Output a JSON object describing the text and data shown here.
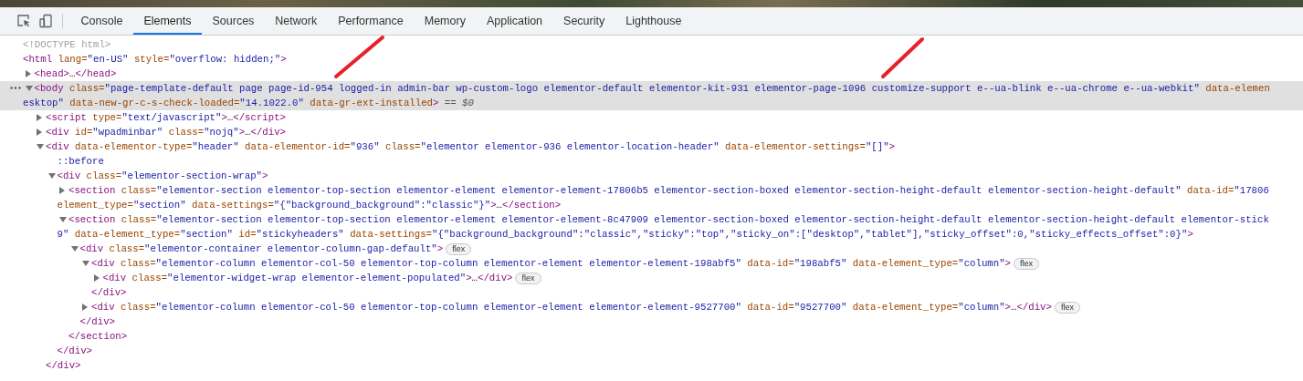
{
  "toolbar": {
    "tabs": [
      {
        "label": "Console",
        "selected": false
      },
      {
        "label": "Elements",
        "selected": true
      },
      {
        "label": "Sources",
        "selected": false
      },
      {
        "label": "Network",
        "selected": false
      },
      {
        "label": "Performance",
        "selected": false
      },
      {
        "label": "Memory",
        "selected": false
      },
      {
        "label": "Application",
        "selected": false
      },
      {
        "label": "Security",
        "selected": false
      },
      {
        "label": "Lighthouse",
        "selected": false
      }
    ]
  },
  "dom_tree": [
    {
      "selected": false,
      "lines": [
        [
          {
            "kind": "doctype",
            "text": "<!DOCTYPE html>"
          }
        ]
      ]
    },
    {
      "selected": false,
      "lines": [
        [
          {
            "kind": "tag",
            "text": "<html"
          },
          {
            "kind": "attr",
            "text": " lang="
          },
          {
            "kind": "value",
            "text": "\"en-US\""
          },
          {
            "kind": "attr",
            "text": " style="
          },
          {
            "kind": "value",
            "text": "\"overflow: hidden;\""
          },
          {
            "kind": "tag",
            "text": ">"
          }
        ]
      ],
      "children": [
        {
          "expanded": false,
          "selected": false,
          "lines": [
            [
              {
                "kind": "tag",
                "text": "<head>"
              },
              {
                "kind": "plain",
                "text": "…"
              },
              {
                "kind": "tag",
                "text": "</head>"
              }
            ]
          ]
        },
        {
          "expanded": true,
          "selected": true,
          "lines": [
            [
              {
                "kind": "tag",
                "text": "<body"
              },
              {
                "kind": "attr",
                "text": " class="
              },
              {
                "kind": "value",
                "text": "\"page-template-default page page-id-954 logged-in admin-bar wp-custom-logo elementor-default elementor-kit-931 elementor-page-1096 customize-support e--ua-blink e--ua-chrome e--ua-webkit\""
              },
              {
                "kind": "attr",
                "text": " data-elemen"
              }
            ],
            [
              {
                "kind": "value",
                "text": "esktop\""
              },
              {
                "kind": "attr",
                "text": " data-new-gr-c-s-check-loaded="
              },
              {
                "kind": "value",
                "text": "\"14.1022.0\""
              },
              {
                "kind": "attr",
                "text": " data-gr-ext-installed"
              },
              {
                "kind": "tag",
                "text": ">"
              },
              {
                "kind": "ref",
                "text": " == $0"
              }
            ]
          ],
          "children": [
            {
              "expanded": false,
              "selected": false,
              "lines": [
                [
                  {
                    "kind": "tag",
                    "text": "<script"
                  },
                  {
                    "kind": "attr",
                    "text": " type="
                  },
                  {
                    "kind": "value",
                    "text": "\"text/javascript\""
                  },
                  {
                    "kind": "tag",
                    "text": ">"
                  },
                  {
                    "kind": "plain",
                    "text": "…"
                  },
                  {
                    "kind": "tag",
                    "text": "</script>"
                  }
                ]
              ]
            },
            {
              "expanded": false,
              "selected": false,
              "lines": [
                [
                  {
                    "kind": "tag",
                    "text": "<div"
                  },
                  {
                    "kind": "attr",
                    "text": " id="
                  },
                  {
                    "kind": "value",
                    "text": "\"wpadminbar\""
                  },
                  {
                    "kind": "attr",
                    "text": " class="
                  },
                  {
                    "kind": "value",
                    "text": "\"nojq\""
                  },
                  {
                    "kind": "tag",
                    "text": ">"
                  },
                  {
                    "kind": "plain",
                    "text": "…"
                  },
                  {
                    "kind": "tag",
                    "text": "</div>"
                  }
                ]
              ]
            },
            {
              "expanded": true,
              "selected": false,
              "lines": [
                [
                  {
                    "kind": "tag",
                    "text": "<div"
                  },
                  {
                    "kind": "attr",
                    "text": " data-elementor-type="
                  },
                  {
                    "kind": "value",
                    "text": "\"header\""
                  },
                  {
                    "kind": "attr",
                    "text": " data-elementor-id="
                  },
                  {
                    "kind": "value",
                    "text": "\"936\""
                  },
                  {
                    "kind": "attr",
                    "text": " class="
                  },
                  {
                    "kind": "value",
                    "text": "\"elementor elementor-936 elementor-location-header\""
                  },
                  {
                    "kind": "attr",
                    "text": " data-elementor-settings="
                  },
                  {
                    "kind": "value",
                    "text": "\"[]\""
                  },
                  {
                    "kind": "tag",
                    "text": ">"
                  }
                ]
              ],
              "children": [
                {
                  "selected": false,
                  "lines": [
                    [
                      {
                        "kind": "pseudo",
                        "text": "::before"
                      }
                    ]
                  ]
                },
                {
                  "expanded": true,
                  "selected": false,
                  "lines": [
                    [
                      {
                        "kind": "tag",
                        "text": "<div"
                      },
                      {
                        "kind": "attr",
                        "text": " class="
                      },
                      {
                        "kind": "value",
                        "text": "\"elementor-section-wrap\""
                      },
                      {
                        "kind": "tag",
                        "text": ">"
                      }
                    ]
                  ],
                  "children": [
                    {
                      "expanded": false,
                      "selected": false,
                      "lines": [
                        [
                          {
                            "kind": "tag",
                            "text": "<section"
                          },
                          {
                            "kind": "attr",
                            "text": " class="
                          },
                          {
                            "kind": "value",
                            "text": "\"elementor-section elementor-top-section elementor-element elementor-element-17806b5 elementor-section-boxed elementor-section-height-default elementor-section-height-default\""
                          },
                          {
                            "kind": "attr",
                            "text": " data-id="
                          },
                          {
                            "kind": "value",
                            "text": "\"17806"
                          }
                        ],
                        [
                          {
                            "kind": "attr",
                            "text": "element_type="
                          },
                          {
                            "kind": "value",
                            "text": "\"section\""
                          },
                          {
                            "kind": "attr",
                            "text": " data-settings="
                          },
                          {
                            "kind": "value",
                            "text": "\"{\"background_background\":\"classic\"}\""
                          },
                          {
                            "kind": "tag",
                            "text": ">"
                          },
                          {
                            "kind": "plain",
                            "text": "…"
                          },
                          {
                            "kind": "tag",
                            "text": "</section>"
                          }
                        ]
                      ]
                    },
                    {
                      "expanded": true,
                      "selected": false,
                      "lines": [
                        [
                          {
                            "kind": "tag",
                            "text": "<section"
                          },
                          {
                            "kind": "attr",
                            "text": " class="
                          },
                          {
                            "kind": "value",
                            "text": "\"elementor-section elementor-top-section elementor-element elementor-element-8c47909 elementor-section-boxed elementor-section-height-default elementor-section-height-default elementor-stick"
                          }
                        ],
                        [
                          {
                            "kind": "value",
                            "text": "9\""
                          },
                          {
                            "kind": "attr",
                            "text": " data-element_type="
                          },
                          {
                            "kind": "value",
                            "text": "\"section\""
                          },
                          {
                            "kind": "attr",
                            "text": " id="
                          },
                          {
                            "kind": "value",
                            "text": "\"stickyheaders\""
                          },
                          {
                            "kind": "attr",
                            "text": " data-settings="
                          },
                          {
                            "kind": "value",
                            "text": "\"{\"background_background\":\"classic\",\"sticky\":\"top\",\"sticky_on\":[\"desktop\",\"tablet\"],\"sticky_offset\":0,\"sticky_effects_offset\":0}\""
                          },
                          {
                            "kind": "tag",
                            "text": ">"
                          }
                        ]
                      ],
                      "children": [
                        {
                          "expanded": true,
                          "selected": false,
                          "badge": "flex",
                          "lines": [
                            [
                              {
                                "kind": "tag",
                                "text": "<div"
                              },
                              {
                                "kind": "attr",
                                "text": " class="
                              },
                              {
                                "kind": "value",
                                "text": "\"elementor-container elementor-column-gap-default\""
                              },
                              {
                                "kind": "tag",
                                "text": ">"
                              }
                            ]
                          ],
                          "children": [
                            {
                              "expanded": true,
                              "selected": false,
                              "badge": "flex",
                              "lines": [
                                [
                                  {
                                    "kind": "tag",
                                    "text": "<div"
                                  },
                                  {
                                    "kind": "attr",
                                    "text": " class="
                                  },
                                  {
                                    "kind": "value",
                                    "text": "\"elementor-column elementor-col-50 elementor-top-column elementor-element elementor-element-198abf5\""
                                  },
                                  {
                                    "kind": "attr",
                                    "text": " data-id="
                                  },
                                  {
                                    "kind": "value",
                                    "text": "\"198abf5\""
                                  },
                                  {
                                    "kind": "attr",
                                    "text": " data-element_type="
                                  },
                                  {
                                    "kind": "value",
                                    "text": "\"column\""
                                  },
                                  {
                                    "kind": "tag",
                                    "text": ">"
                                  }
                                ]
                              ],
                              "children": [
                                {
                                  "expanded": false,
                                  "selected": false,
                                  "badge": "flex",
                                  "lines": [
                                    [
                                      {
                                        "kind": "tag",
                                        "text": "<div"
                                      },
                                      {
                                        "kind": "attr",
                                        "text": " class="
                                      },
                                      {
                                        "kind": "value",
                                        "text": "\"elementor-widget-wrap elementor-element-populated\""
                                      },
                                      {
                                        "kind": "tag",
                                        "text": ">"
                                      },
                                      {
                                        "kind": "plain",
                                        "text": "…"
                                      },
                                      {
                                        "kind": "tag",
                                        "text": "</div>"
                                      }
                                    ]
                                  ]
                                }
                              ],
                              "closing": [
                                {
                                  "kind": "tag",
                                  "text": "</div>"
                                }
                              ]
                            },
                            {
                              "expanded": false,
                              "selected": false,
                              "badge": "flex",
                              "lines": [
                                [
                                  {
                                    "kind": "tag",
                                    "text": "<div"
                                  },
                                  {
                                    "kind": "attr",
                                    "text": " class="
                                  },
                                  {
                                    "kind": "value",
                                    "text": "\"elementor-column elementor-col-50 elementor-top-column elementor-element elementor-element-9527700\""
                                  },
                                  {
                                    "kind": "attr",
                                    "text": " data-id="
                                  },
                                  {
                                    "kind": "value",
                                    "text": "\"9527700\""
                                  },
                                  {
                                    "kind": "attr",
                                    "text": " data-element_type="
                                  },
                                  {
                                    "kind": "value",
                                    "text": "\"column\""
                                  },
                                  {
                                    "kind": "tag",
                                    "text": ">"
                                  },
                                  {
                                    "kind": "plain",
                                    "text": "…"
                                  },
                                  {
                                    "kind": "tag",
                                    "text": "</div>"
                                  }
                                ]
                              ]
                            }
                          ],
                          "closing": [
                            {
                              "kind": "tag",
                              "text": "</div>"
                            }
                          ]
                        }
                      ],
                      "closing": [
                        {
                          "kind": "tag",
                          "text": "</section>"
                        }
                      ]
                    }
                  ],
                  "closing": [
                    {
                      "kind": "tag",
                      "text": "</div>"
                    }
                  ]
                }
              ],
              "closing": [
                {
                  "kind": "tag",
                  "text": "</div>"
                }
              ]
            }
          ]
        }
      ]
    }
  ]
}
